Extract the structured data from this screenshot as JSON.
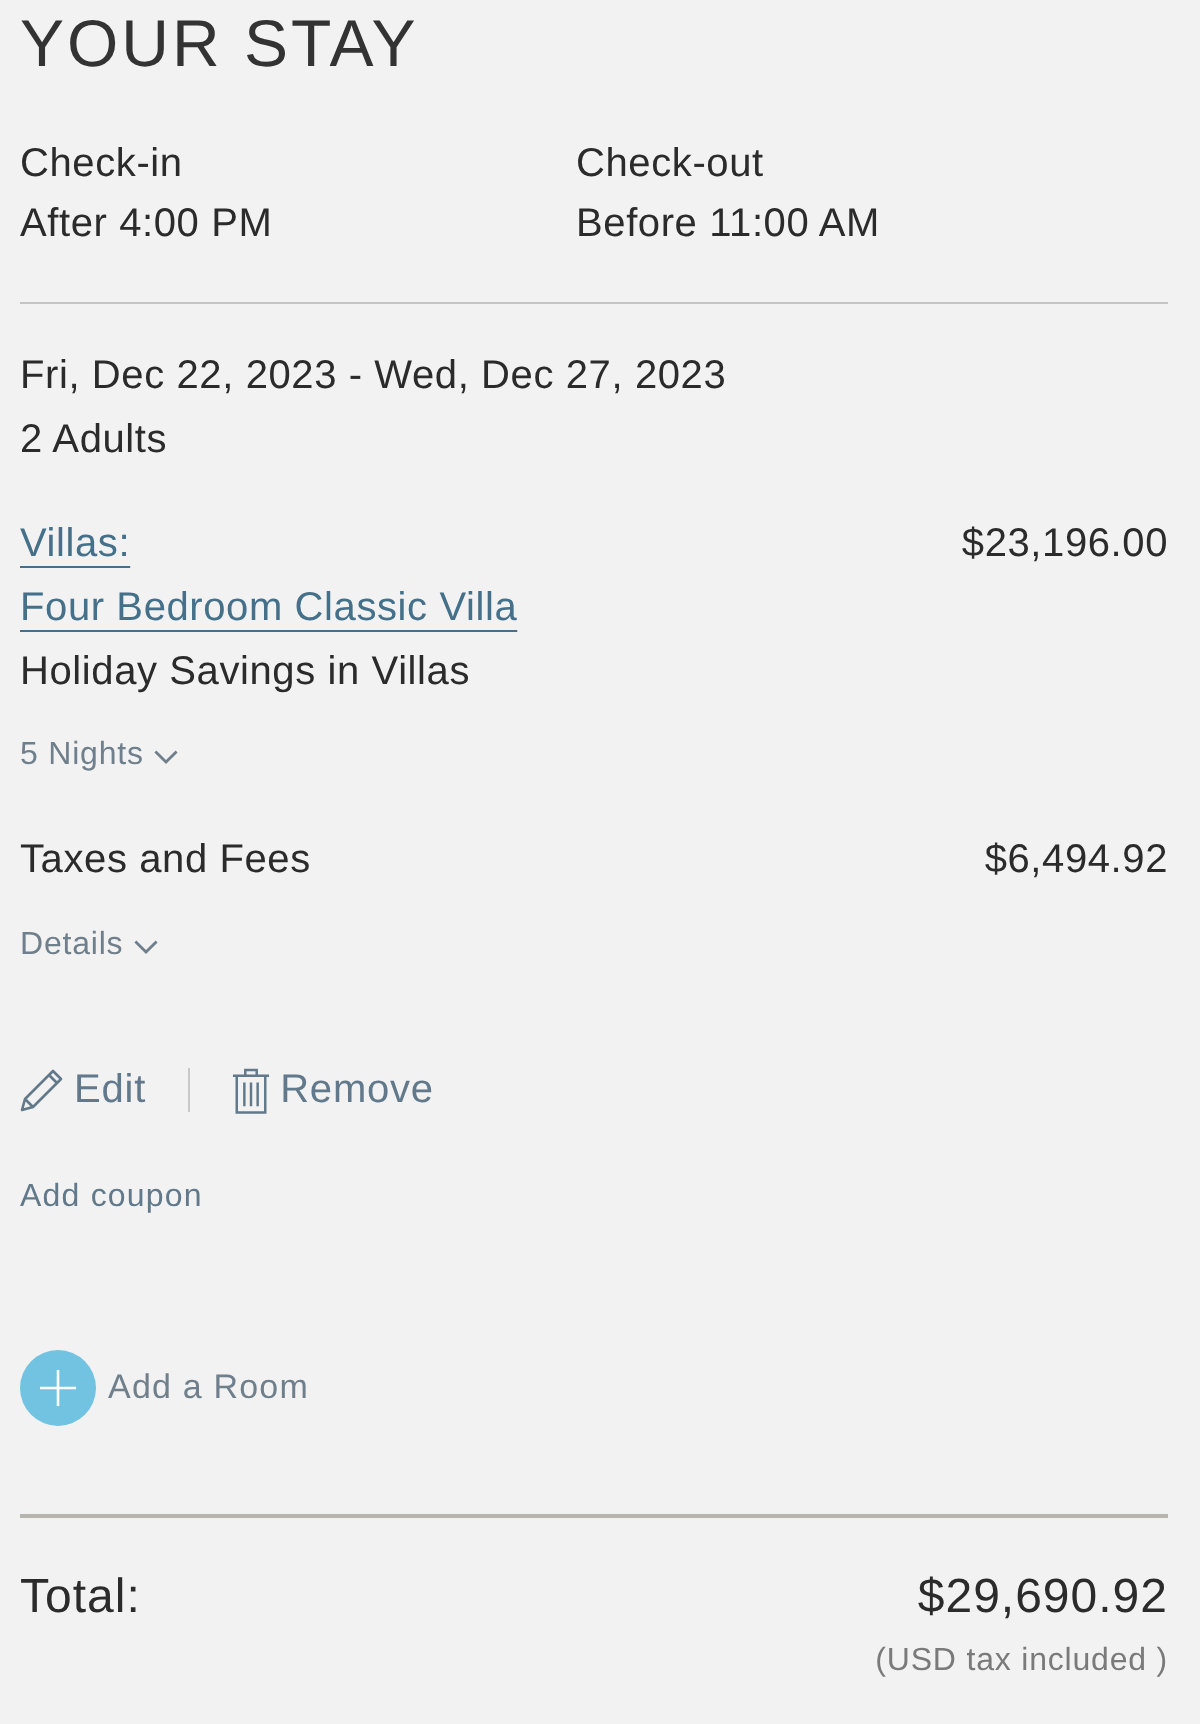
{
  "title": "YOUR STAY",
  "times": [
    {
      "label": "Check-in",
      "value": "After 4:00 PM"
    },
    {
      "label": "Check-out",
      "value": "Before 11:00 AM"
    }
  ],
  "stay": {
    "dates": "Fri, Dec 22, 2023 - Wed, Dec 27, 2023",
    "guests": "2 Adults"
  },
  "room": {
    "category": "Villas:",
    "name": "Four Bedroom Classic Villa",
    "rate": "Holiday Savings in Villas",
    "price": "$23,196.00",
    "nights_toggle": {
      "label": "5 Nights",
      "expanded": false
    }
  },
  "taxes": {
    "label": "Taxes and Fees",
    "amount": "$6,494.92",
    "details_toggle": {
      "label": "Details",
      "expanded": false
    }
  },
  "actions": [
    {
      "kind": "edit",
      "label": "Edit"
    },
    {
      "kind": "remove",
      "label": "Remove"
    }
  ],
  "coupon_link": "Add coupon",
  "add_room": "Add a Room",
  "total": {
    "label": "Total:",
    "amount": "$29,690.92",
    "note": "(USD tax included )"
  }
}
